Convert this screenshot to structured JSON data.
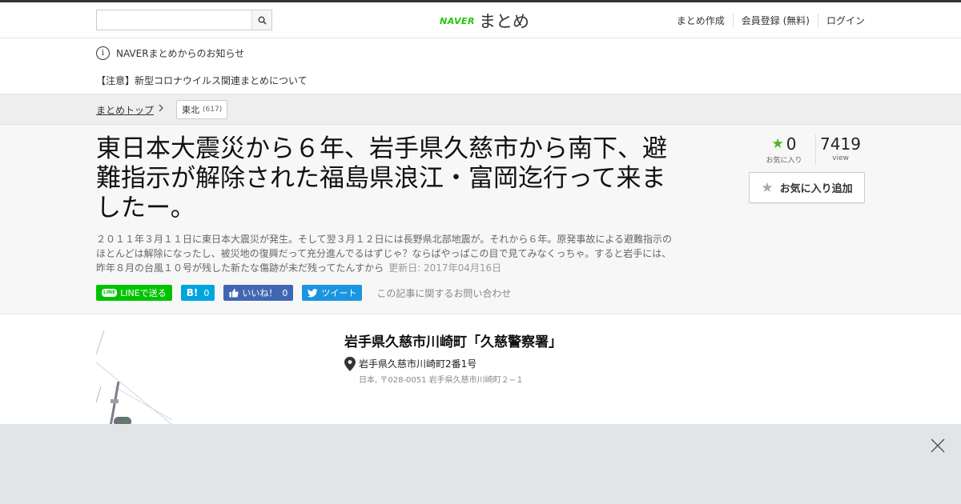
{
  "header": {
    "search_value": "",
    "search_placeholder": "",
    "logo_naver": "NAVER",
    "logo_matome": "まとめ",
    "nav": [
      "まとめ作成",
      "会員登録 (無料)",
      "ログイン"
    ]
  },
  "notice": {
    "heading": "NAVERまとめからのお知らせ",
    "link": "【注意】新型コロナウイルス関連まとめについて"
  },
  "breadcrumb": {
    "top": "まとめトップ",
    "tag": "東北",
    "tag_count": "(617)"
  },
  "article": {
    "title": "東日本大震災から６年、岩手県久慈市から南下、避難指示が解除された福島県浪江・富岡迄行って来ましたー。",
    "description": "２０１１年３月１１日に東日本大震災が発生。そして翌３月１２日には長野県北部地震が。それから６年。原発事故による避難指示のほとんどは解除になったし、被災地の復興だって充分進んでるはずじゃ？ならばやっぱこの目で見てみなくっちゃ。すると岩手には、昨年８月の台風１０号が残した新たな傷跡が未だ残ってたんすから",
    "updated": "更新日: 2017年04月16日",
    "fav_count": "0",
    "fav_label": "お気に入り",
    "view_count": "7419",
    "view_label": "view",
    "fav_button": "お気に入り追加"
  },
  "share": {
    "line": "LINEで送る",
    "hatena_icon": "B!",
    "hatena_count": "0",
    "fb_label": "いいね！",
    "fb_count": "0",
    "tweet": "ツイート",
    "contact": "この記事に関するお問い合わせ"
  },
  "content": {
    "place_title": "岩手県久慈市川崎町「久慈警察署」",
    "address": "岩手県久慈市川崎町2番1号",
    "address_sub": "日本, 〒028-0051 岩手県久慈市川崎町２−１"
  },
  "colors": {
    "naver_green": "#1ec800",
    "line_green": "#00c300",
    "hatena_blue": "#00a4de",
    "facebook_blue": "#4267b2",
    "twitter_blue": "#1b95e0",
    "fav_star_green": "#4bb51e"
  },
  "icons": [
    "search-icon",
    "info-icon",
    "chevron-right-icon",
    "star-icon",
    "map-pin-icon",
    "close-icon",
    "line-icon",
    "hatena-icon",
    "thumbs-up-icon",
    "twitter-bird-icon"
  ]
}
